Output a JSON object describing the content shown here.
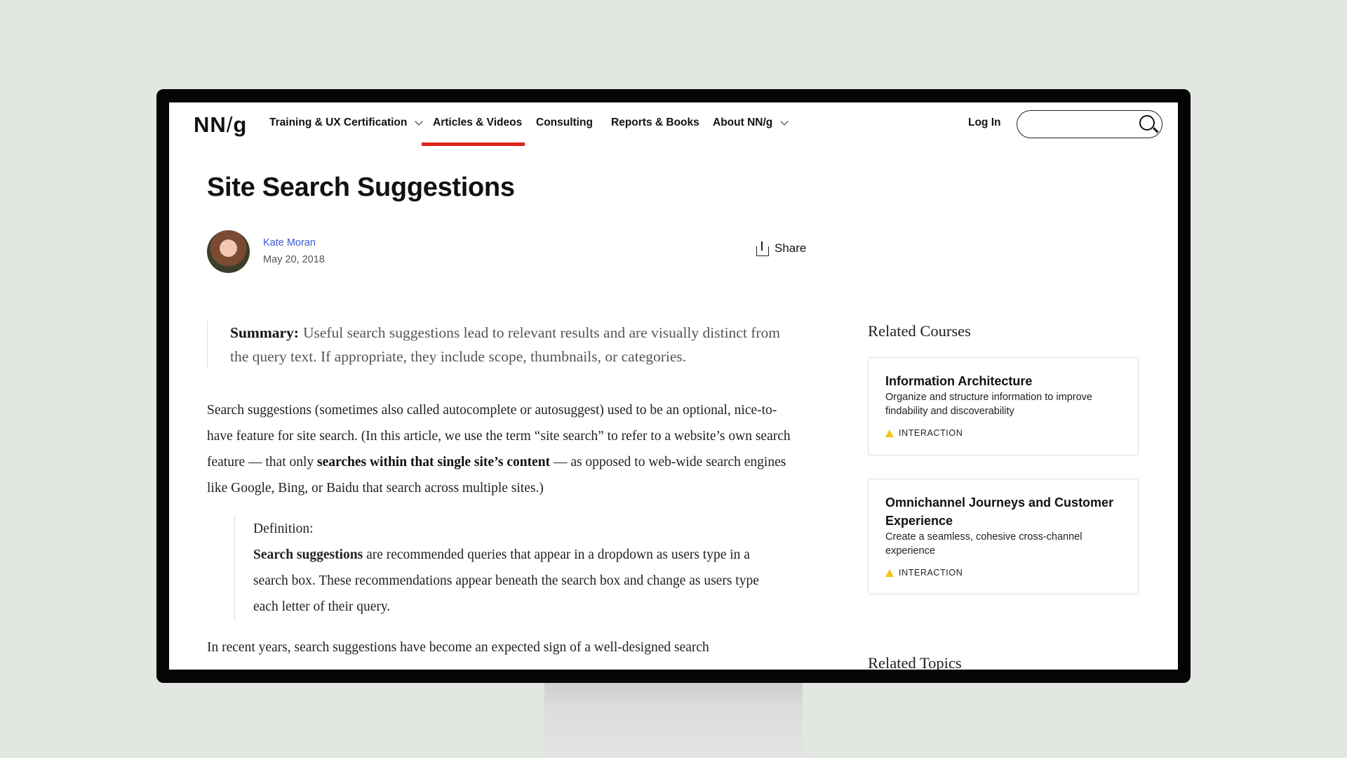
{
  "colors": {
    "accent": "#e0251b",
    "link": "#3a5bd9",
    "tag_icon": "#f5c518"
  },
  "header": {
    "logo": {
      "left": "NN",
      "slash": "/",
      "right": "g"
    },
    "nav": [
      {
        "label": "Training & UX Certification",
        "dropdown": true
      },
      {
        "label": "Articles & Videos",
        "active": true
      },
      {
        "label": "Consulting"
      },
      {
        "label": "Reports & Books"
      },
      {
        "label": "About NN/g",
        "dropdown": true
      }
    ],
    "login": "Log In",
    "search": {
      "placeholder": "",
      "icon": "search-icon"
    }
  },
  "article": {
    "title": "Site Search Suggestions",
    "author": "Kate Moran",
    "date": "May 20, 2018",
    "share": "Share",
    "summary_label": "Summary:",
    "summary": "Useful search suggestions lead to relevant results and are visually distinct from the query text. If appropriate, they include scope, thumbnails, or categories.",
    "p1_a": "Search suggestions (sometimes also called autocomplete or autosuggest) used to be an optional, nice-to-have feature for site search. (In this article, we use the term “site search” to refer to a website’s own search feature — that only ",
    "p1_bold": "searches within that single site’s content",
    "p1_b": " — as opposed to web-wide search engines like Google, Bing, or Baidu that search across multiple sites.)",
    "definition_label": "Definition:",
    "definition_bold": "Search suggestions",
    "definition": " are recommended queries that appear in a dropdown as users type in a search box. These recommendations appear beneath the search box and change as users type each letter of their query.",
    "p2": "In recent years, search suggestions have become an expected sign of a well-designed search"
  },
  "sidebar": {
    "related_courses": "Related Courses",
    "courses": [
      {
        "title": "Information Architecture",
        "desc": "Organize and structure information to improve findability and discoverability",
        "tag": "INTERACTION"
      },
      {
        "title": "Omnichannel Journeys and Customer Experience",
        "desc": "Create a seamless, cohesive cross-channel experience",
        "tag": "INTERACTION"
      }
    ],
    "related_topics": "Related Topics"
  }
}
